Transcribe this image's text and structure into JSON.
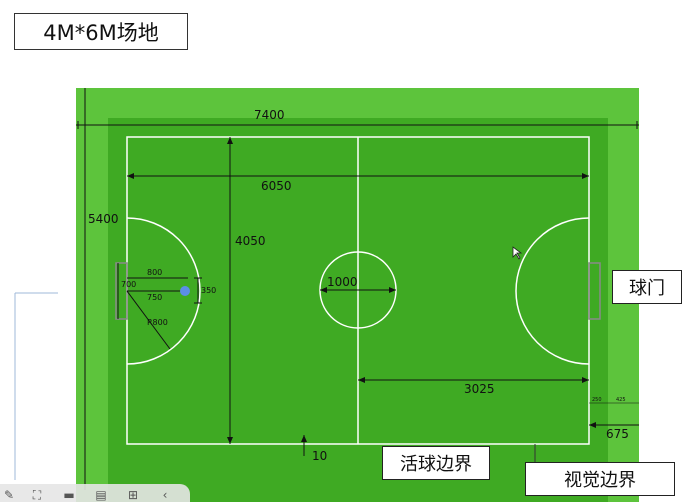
{
  "title": "4M*6M场地",
  "callouts": {
    "goal": "球门",
    "live_ball_boundary": "活球边界",
    "visual_boundary": "视觉边界"
  },
  "dimensions": {
    "outer_width": "7400",
    "outer_height": "5400",
    "field_length": "6050",
    "field_width": "4050",
    "goal_width": "700",
    "penalty_depth": "800",
    "penalty_spot": "750",
    "spot_offset": "350",
    "penalty_radius": "R800",
    "center_circle": "1000",
    "half_length": "3025",
    "margin": "675",
    "small_a": "250",
    "small_b": "425",
    "line_width": "10"
  },
  "colors": {
    "outer_green": "#5dc43c",
    "field_green": "#3faa23",
    "line_white": "#ffffff",
    "dim_black": "#111111",
    "marker_blue": "#5b8ee6"
  }
}
